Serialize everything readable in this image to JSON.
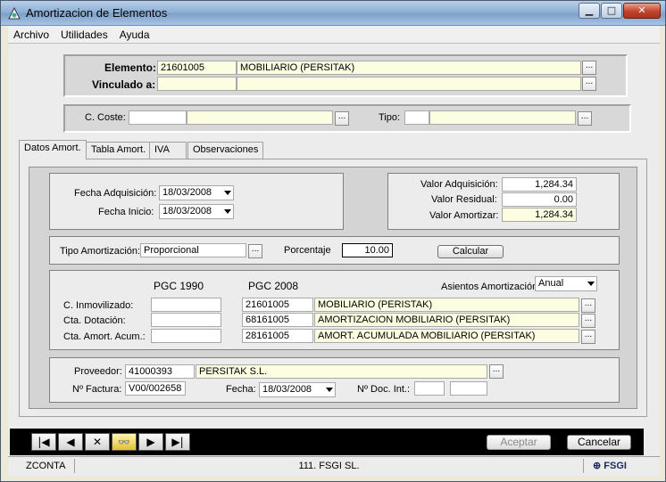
{
  "window": {
    "title": "Amortizacion de Elementos",
    "min_glyph": "▁",
    "max_glyph": "□",
    "close_glyph": "✕"
  },
  "menu": [
    "Archivo",
    "Utilidades",
    "Ayuda"
  ],
  "header": {
    "elemento_label": "Elemento:",
    "elemento_code": "21601005",
    "elemento_desc": "MOBILIARIO (PERSITAK)",
    "vinculado_label": "Vinculado a:",
    "vinculado_code": "",
    "vinculado_desc": ""
  },
  "coste": {
    "label": "C. Coste:",
    "code": "",
    "desc": "",
    "tipo_label": "Tipo:",
    "tipo_code": "",
    "tipo_desc": ""
  },
  "tabs": [
    "Datos Amort.",
    "Tabla Amort.",
    "IVA",
    "Observaciones"
  ],
  "fechas": {
    "adq_label": "Fecha Adquisición:",
    "adq_value": "18/03/2008",
    "inicio_label": "Fecha Inicio:",
    "inicio_value": "18/03/2008"
  },
  "valores": {
    "adq_label": "Valor Adquisición:",
    "adq_value": "1,284.34",
    "residual_label": "Valor Residual:",
    "residual_value": "0.00",
    "amortizar_label": "Valor Amortizar:",
    "amortizar_value": "1,284.34"
  },
  "tipo_amort": {
    "label": "Tipo Amortización:",
    "value": "Proporcional",
    "pct_label": "Porcentaje",
    "pct_value": "10.00",
    "calc_button": "Calcular"
  },
  "cuentas": {
    "col_1990": "PGC 1990",
    "col_2008": "PGC 2008",
    "asientos_label": "Asientos Amortización:",
    "asientos_value": "Anual",
    "rows": [
      {
        "label": "C. Inmovilizado:",
        "pgc1990": "",
        "pgc2008": "21601005",
        "desc": "MOBILIARIO (PERISTAK)"
      },
      {
        "label": "Cta. Dotación:",
        "pgc1990": "",
        "pgc2008": "68161005",
        "desc": "AMORTIZACION MOBILIARIO (PERSITAK)"
      },
      {
        "label": "Cta. Amort. Acum.:",
        "pgc1990": "",
        "pgc2008": "28161005",
        "desc": "AMORT. ACUMULADA MOBILIARIO (PERSITAK)"
      }
    ]
  },
  "proveedor": {
    "label": "Proveedor:",
    "code": "41000393",
    "name": "PERSITAK S.L.",
    "factura_label": "Nº Factura:",
    "factura_value": "V00/002658",
    "fecha_label": "Fecha:",
    "fecha_value": "18/03/2008",
    "docint_label": "Nº Doc. Int.:",
    "docint_1": "",
    "docint_2": ""
  },
  "nav": {
    "first": "|◀",
    "prev": "◀",
    "delete": "✕",
    "search": "🔍",
    "next": "▶",
    "last": "▶|"
  },
  "actions": {
    "accept": "Aceptar",
    "cancel": "Cancelar"
  },
  "status": {
    "left": "ZCONTA",
    "center": "111. FSGI SL.",
    "logo": "FSGI"
  }
}
